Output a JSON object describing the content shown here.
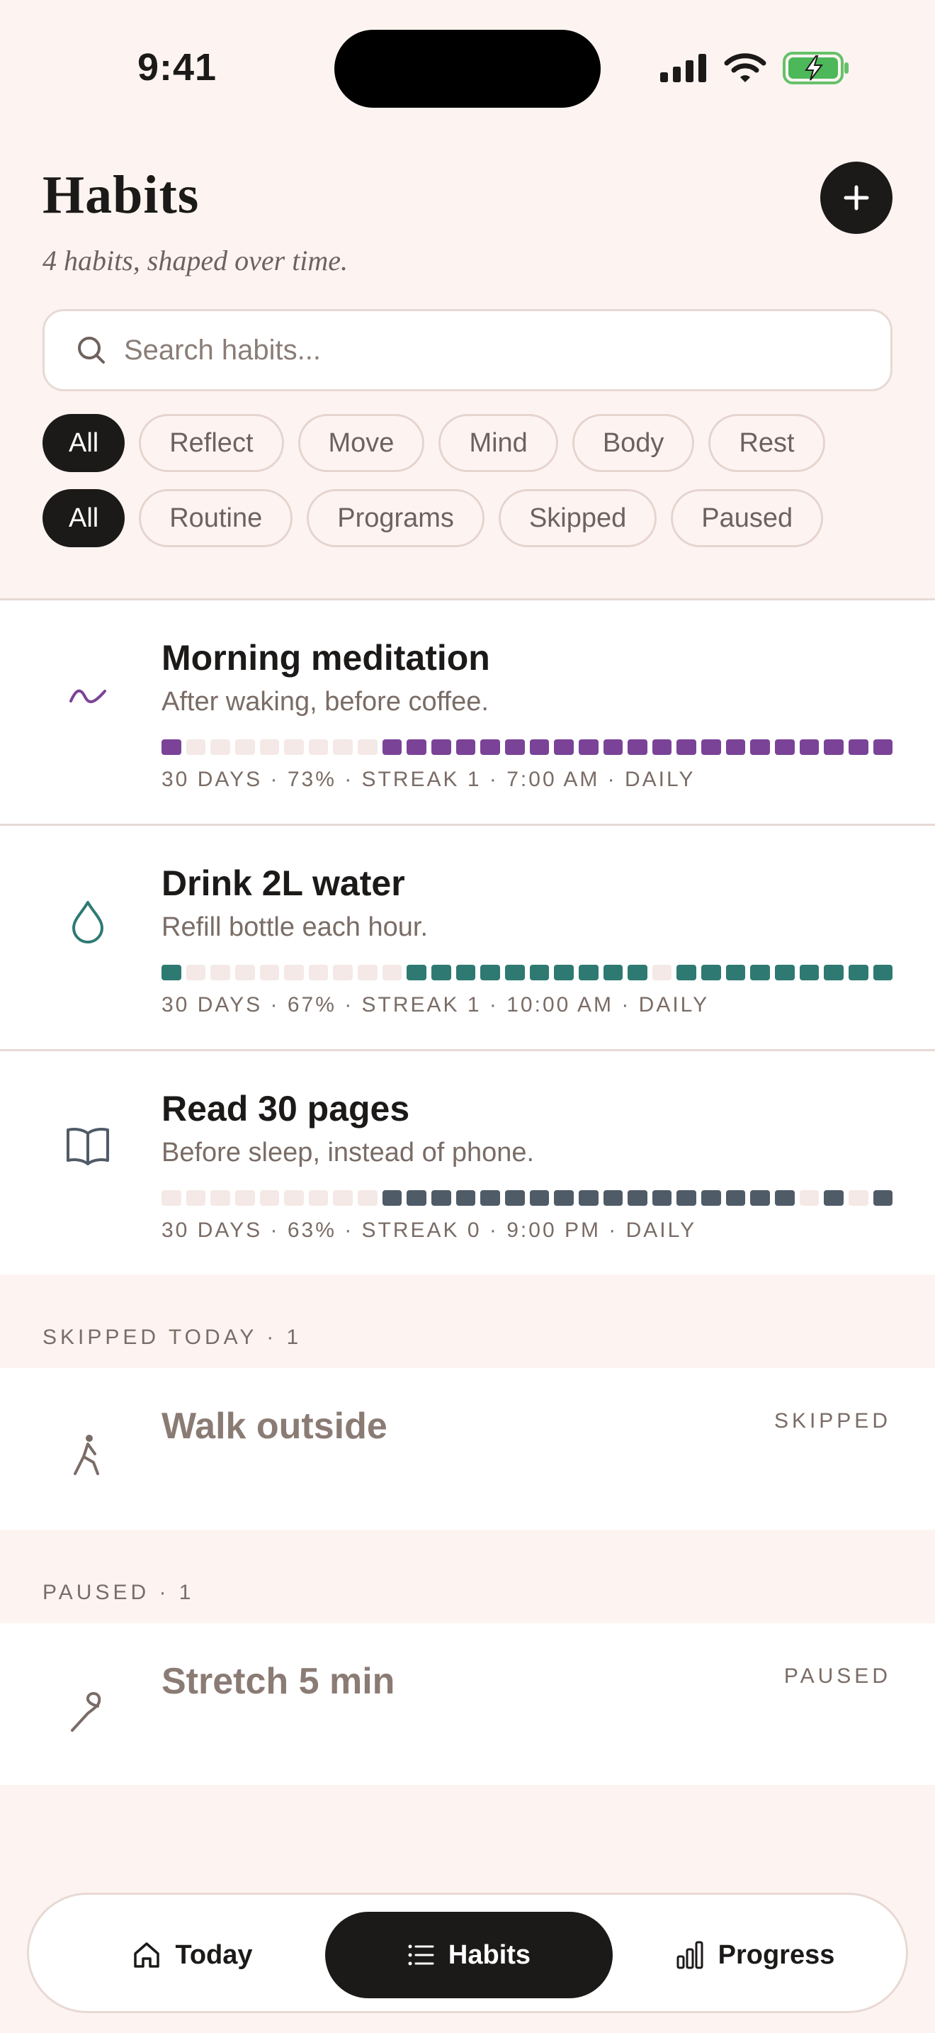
{
  "status_bar": {
    "time": "9:41"
  },
  "header": {
    "title": "Habits",
    "subtitle": "4 habits, shaped over time."
  },
  "search": {
    "placeholder": "Search habits..."
  },
  "category_filters": [
    {
      "label": "All",
      "active": true
    },
    {
      "label": "Reflect",
      "active": false
    },
    {
      "label": "Move",
      "active": false
    },
    {
      "label": "Mind",
      "active": false
    },
    {
      "label": "Body",
      "active": false
    },
    {
      "label": "Rest",
      "active": false
    }
  ],
  "status_filters": [
    {
      "label": "All",
      "active": true
    },
    {
      "label": "Routine",
      "active": false
    },
    {
      "label": "Programs",
      "active": false
    },
    {
      "label": "Skipped",
      "active": false
    },
    {
      "label": "Paused",
      "active": false
    }
  ],
  "habits": [
    {
      "name": "Morning meditation",
      "description": "After waking, before coffee.",
      "meta": "30 DAYS · 73% · STREAK 1 · 7:00 AM · DAILY",
      "icon": "wave-icon",
      "color": "#7B4397",
      "history": [
        1,
        0,
        0,
        0,
        0,
        0,
        0,
        0,
        0,
        1,
        1,
        1,
        1,
        1,
        1,
        1,
        1,
        1,
        1,
        1,
        1,
        1,
        1,
        1,
        1,
        1,
        1,
        1,
        1,
        1
      ]
    },
    {
      "name": "Drink 2L water",
      "description": "Refill bottle each hour.",
      "meta": "30 DAYS · 67% · STREAK 1 · 10:00 AM · DAILY",
      "icon": "droplet-icon",
      "color": "#2E7A72",
      "history": [
        1,
        0,
        0,
        0,
        0,
        0,
        0,
        0,
        0,
        0,
        1,
        1,
        1,
        1,
        1,
        1,
        1,
        1,
        1,
        1,
        0,
        1,
        1,
        1,
        1,
        1,
        1,
        1,
        1,
        1
      ]
    },
    {
      "name": "Read 30 pages",
      "description": "Before sleep, instead of phone.",
      "meta": "30 DAYS · 63% · STREAK 0 · 9:00 PM · DAILY",
      "icon": "book-icon",
      "color": "#505B68",
      "history": [
        0,
        0,
        0,
        0,
        0,
        0,
        0,
        0,
        0,
        1,
        1,
        1,
        1,
        1,
        1,
        1,
        1,
        1,
        1,
        1,
        1,
        1,
        1,
        1,
        1,
        1,
        0,
        1,
        0,
        1
      ]
    }
  ],
  "skipped_section": {
    "label": "SKIPPED TODAY · 1",
    "habit": {
      "name": "Walk outside",
      "status": "SKIPPED",
      "icon": "walk-icon"
    }
  },
  "paused_section": {
    "label": "PAUSED · 1",
    "habit": {
      "name": "Stretch 5 min",
      "status": "PAUSED",
      "icon": "stretch-icon"
    }
  },
  "tab_bar": {
    "today": "Today",
    "habits": "Habits",
    "progress": "Progress"
  }
}
